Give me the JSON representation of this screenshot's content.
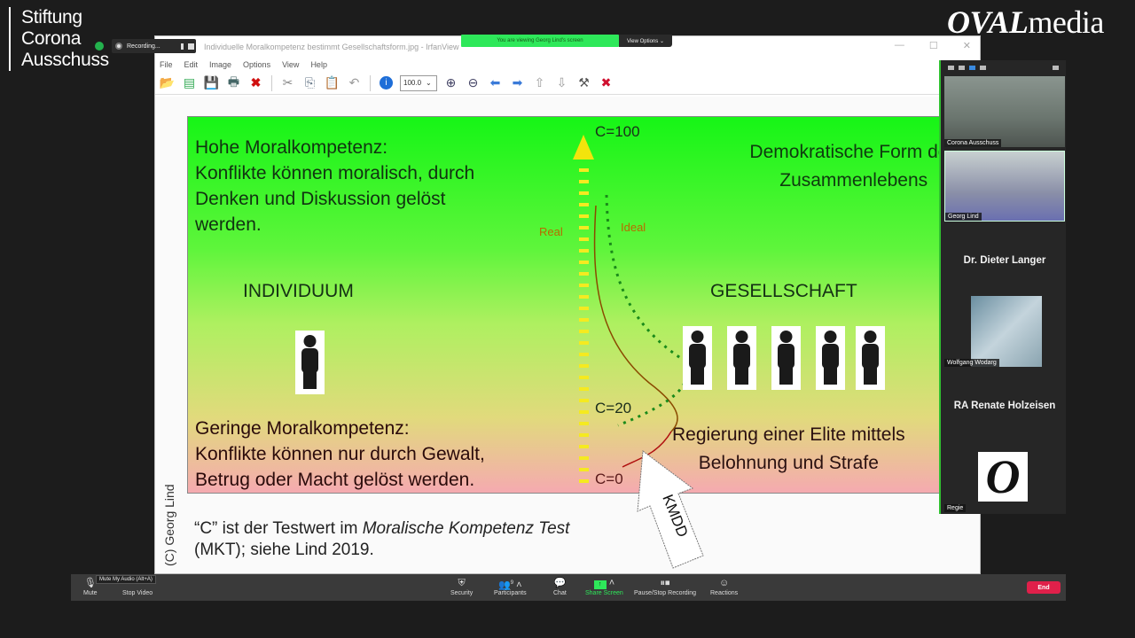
{
  "branding": {
    "left_logo_lines": [
      "Stiftung",
      "Corona",
      "Ausschuss"
    ],
    "right_logo_bold": "OVAL",
    "right_logo_rest": "media"
  },
  "recording": {
    "label": "Recording..."
  },
  "share_banner": {
    "text": "You are viewing Georg Lind's screen",
    "view_options": "View Options ⌄"
  },
  "viewer": {
    "title": "Individuelle Moralkompetenz bestimmt Gesellschaftsform.jpg - IrfanView",
    "menu": [
      "File",
      "Edit",
      "Image",
      "Options",
      "View",
      "Help"
    ],
    "zoom_value": "100.0",
    "toolbar_icons": [
      "open-folder",
      "thumbnails",
      "save",
      "print",
      "delete",
      "cut",
      "copy",
      "paste",
      "undo",
      "info",
      "zoom-select",
      "zoom-in",
      "zoom-out",
      "previous",
      "next",
      "page-up",
      "page-down",
      "settings",
      "exit"
    ]
  },
  "slide": {
    "top_text": "Hohe Moralkompetenz:\nKonflikte können moralisch, durch\nDenken und Diskussion gelöst\nwerden.",
    "bottom_text": "Geringe Moralkompetenz:\nKonflikte können nur durch Gewalt,\nBetrug oder Macht gelöst werden.",
    "left_heading": "INDIVIDUUM",
    "right_heading": "GESELLSCHAFT",
    "top_right": "Demokratische Form des\nZusammenlebens",
    "bottom_right": "Regierung einer Elite mittels\nBelohnung und Strafe",
    "label_real": "Real",
    "label_ideal": "Ideal",
    "c100": "C=100",
    "c20": "C=20",
    "c0": "C=0",
    "arrow_label": "KMDD",
    "caption_pre": "“C” ist der Testwert im ",
    "caption_italic": "Moralische Kompetenz Test",
    "caption_post": "(MKT); siehe Lind 2019.",
    "copyright": "(C) Georg Lind"
  },
  "gallery": {
    "tiles": [
      {
        "name": "Corona Ausschuss",
        "type": "video"
      },
      {
        "name": "Georg Lind",
        "type": "video"
      },
      {
        "name": "Dr. Dieter Langer",
        "type": "name"
      },
      {
        "name": "Wolfgang Wodarg",
        "type": "image"
      },
      {
        "name": "RA Renate Holzeisen",
        "type": "name"
      },
      {
        "name": "Regie",
        "type": "logo"
      }
    ]
  },
  "controls": {
    "mute": "Mute",
    "mute_tooltip": "Mute My Audio (Alt+A)",
    "stop_video": "Stop Video",
    "security": "Security",
    "participants": "Participants",
    "participant_count": "9",
    "chat": "Chat",
    "share_screen": "Share Screen",
    "recording": "Pause/Stop Recording",
    "reactions": "Reactions",
    "end": "End"
  },
  "colors": {
    "end": "#e0204a",
    "share": "#2ee85a"
  }
}
